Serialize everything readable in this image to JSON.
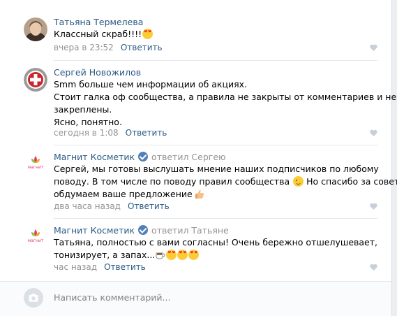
{
  "comments": [
    {
      "author": "Татьяна Термелева",
      "reply_to": "",
      "lines": [
        "Классный скраб!!!!"
      ],
      "time": "вчера в 23:52",
      "reply_label": "Ответить"
    },
    {
      "author": "Сергей Новожилов",
      "reply_to": "",
      "lines": [
        "Smm больше чем информации об акциях.",
        "Стоит галка оф сообщества, а правила не закрыты от комментариев и не",
        "закреплены.",
        "Ясно, понятно."
      ],
      "time": "сегодня в 1:08",
      "reply_label": "Ответить"
    },
    {
      "author": "Магнит Косметик",
      "reply_to": "ответил Сергею",
      "lines": [
        "Сергей, мы готовы выслушать мнение наших подписчиков по любому",
        "поводу. В том числе по поводу правил сообщества",
        " Но спасибо за совет,",
        "обдумаем ваше предложение"
      ],
      "time": "два часа назад",
      "reply_label": "Ответить",
      "logo_text": "магнит"
    },
    {
      "author": "Магнит Косметик",
      "reply_to": "ответил Татьяне",
      "lines": [
        "Татьяна, полностью с вами согласны! Очень бережно отшелушевает,",
        "тонизирует, а запах..."
      ],
      "time": "час назад",
      "reply_label": "Ответить",
      "logo_text": "магнит"
    }
  ],
  "composer": {
    "placeholder": "Написать комментарий..."
  },
  "colors": {
    "link": "#2a5885",
    "meta": "#939393",
    "verified": "#5181b8"
  },
  "icons": [
    "heart-icon",
    "verified-icon",
    "camera-icon",
    "heart-eyes-emoji",
    "wink-emoji",
    "thumbs-up-emoji",
    "coffee-emoji"
  ]
}
